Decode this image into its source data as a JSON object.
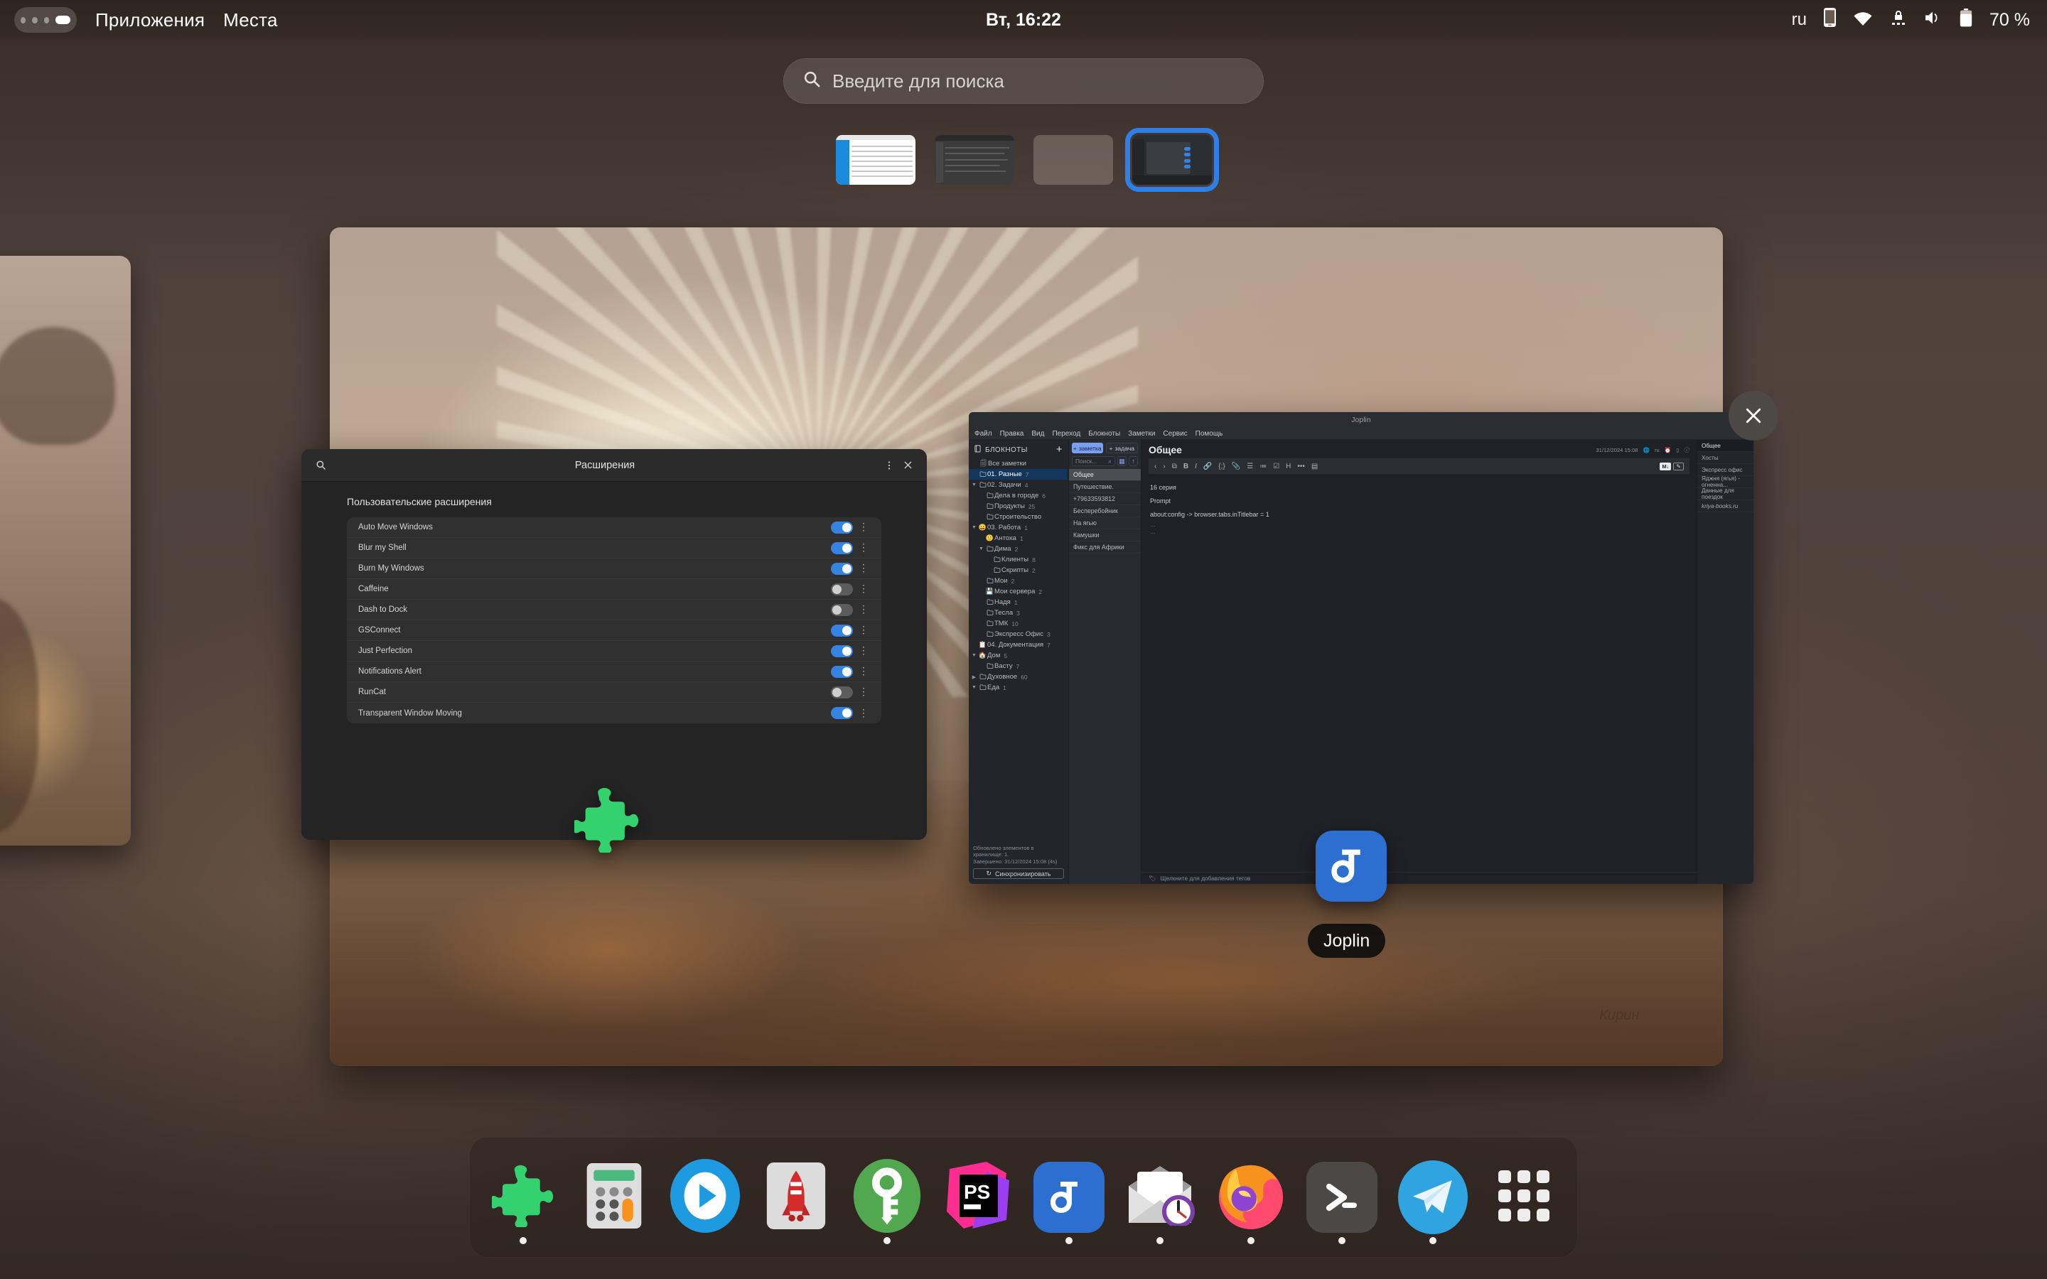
{
  "topbar": {
    "apps_label": "Приложения",
    "places_label": "Места",
    "clock": "Вт, 16:22",
    "lang": "ru",
    "battery": "70 %",
    "icons": [
      "phone-icon",
      "wifi-icon",
      "vpn-lock-icon",
      "volume-icon",
      "battery-icon"
    ]
  },
  "search": {
    "placeholder": "Введите для поиска",
    "icon": "search-icon"
  },
  "workspaces": {
    "count": 4,
    "selected_index": 3,
    "accent": "#2f7fe8"
  },
  "overview": {
    "close_label": "✕",
    "close_icon": "close-icon",
    "wallpaper_signature": "Кирин"
  },
  "extensions_window": {
    "title": "Расширения",
    "search_icon": "search-icon",
    "menu_icon": "kebab-menu-icon",
    "close_icon": "close-icon",
    "section_heading": "Пользовательские расширения",
    "rows": [
      {
        "name": "Auto Move Windows",
        "enabled": true
      },
      {
        "name": "Blur my Shell",
        "enabled": true
      },
      {
        "name": "Burn My Windows",
        "enabled": true
      },
      {
        "name": "Caffeine",
        "enabled": false
      },
      {
        "name": "Dash to Dock",
        "enabled": false
      },
      {
        "name": "GSConnect",
        "enabled": true
      },
      {
        "name": "Just Perfection",
        "enabled": true
      },
      {
        "name": "Notifications Alert",
        "enabled": true
      },
      {
        "name": "RunCat",
        "enabled": false
      },
      {
        "name": "Transparent Window Moving",
        "enabled": true
      }
    ]
  },
  "joplin": {
    "window_title": "Joplin",
    "menu": [
      "Файл",
      "Правка",
      "Вид",
      "Переход",
      "Блокноты",
      "Заметки",
      "Сервис",
      "Помощь"
    ],
    "sidebar": {
      "header": "БЛОКНОТЫ",
      "add_icon": "plus-icon",
      "all_notes": "Все заметки",
      "tree": [
        {
          "label": "01. Разные",
          "count": "7",
          "depth": 0,
          "icon": "folder-icon",
          "caret": "",
          "selected": true
        },
        {
          "label": "02. Задачи",
          "count": "4",
          "depth": 0,
          "icon": "folder-icon",
          "caret": "▼"
        },
        {
          "label": "Дела в городе",
          "count": "6",
          "depth": 1,
          "icon": "folder-icon",
          "caret": ""
        },
        {
          "label": "Продукты",
          "count": "25",
          "depth": 1,
          "icon": "folder-icon",
          "caret": ""
        },
        {
          "label": "Строительство",
          "count": "",
          "depth": 1,
          "icon": "folder-icon",
          "caret": ""
        },
        {
          "label": "03. Работа",
          "count": "1",
          "depth": 0,
          "icon": "😀",
          "caret": "▼"
        },
        {
          "label": "Антоха",
          "count": "1",
          "depth": 1,
          "icon": "🙂",
          "caret": ""
        },
        {
          "label": "Дима",
          "count": "2",
          "depth": 1,
          "icon": "folder-icon",
          "caret": "▼"
        },
        {
          "label": "Клиенты",
          "count": "8",
          "depth": 2,
          "icon": "folder-icon",
          "caret": ""
        },
        {
          "label": "Скрипты",
          "count": "2",
          "depth": 2,
          "icon": "folder-icon",
          "caret": ""
        },
        {
          "label": "Мои",
          "count": "2",
          "depth": 1,
          "icon": "folder-icon",
          "caret": ""
        },
        {
          "label": "Мои сервера",
          "count": "2",
          "depth": 1,
          "icon": "💾",
          "caret": ""
        },
        {
          "label": "Надя",
          "count": "1",
          "depth": 1,
          "icon": "folder-icon",
          "caret": ""
        },
        {
          "label": "Тесла",
          "count": "3",
          "depth": 1,
          "icon": "folder-icon",
          "caret": ""
        },
        {
          "label": "ТМК",
          "count": "10",
          "depth": 1,
          "icon": "folder-icon",
          "caret": ""
        },
        {
          "label": "Экспресс Офис",
          "count": "3",
          "depth": 1,
          "icon": "folder-icon",
          "caret": ""
        },
        {
          "label": "04. Документация",
          "count": "7",
          "depth": 0,
          "icon": "📋",
          "caret": ""
        },
        {
          "label": "Дом",
          "count": "5",
          "depth": 0,
          "icon": "🏠",
          "caret": "▼"
        },
        {
          "label": "Васту",
          "count": "7",
          "depth": 1,
          "icon": "folder-icon",
          "caret": ""
        },
        {
          "label": "Духовное",
          "count": "60",
          "depth": 0,
          "icon": "folder-icon",
          "caret": "▶"
        },
        {
          "label": "Еда",
          "count": "1",
          "depth": 0,
          "icon": "folder-icon",
          "caret": "▼"
        }
      ],
      "sync_message_line1": "Обновлено элементов в хранилище: 1.",
      "sync_message_line2": "Завершено: 31/12/2024 15:08 (4s)",
      "sync_button": "Синхронизировать",
      "sync_icon": "refresh-icon"
    },
    "notelist": {
      "new_note_button": "заметка",
      "new_todo_button": "задача",
      "search_placeholder": "Поиск...",
      "search_icon": "search-icon",
      "calendar_icon": "calendar-icon",
      "sort_icon": "sort-ascending-icon",
      "notes": [
        {
          "title": "Общее",
          "selected": true
        },
        {
          "title": "Путешествие.",
          "selected": false
        },
        {
          "title": "+79633593812",
          "selected": false
        },
        {
          "title": "Бесперебойник",
          "selected": false
        },
        {
          "title": "На ягью",
          "selected": false
        },
        {
          "title": "Камушки",
          "selected": false
        },
        {
          "title": "Фикс для Африки",
          "selected": false
        }
      ]
    },
    "editor": {
      "note_title": "Общее",
      "timestamp": "31/12/2024 15:08",
      "lang": "ru",
      "meta_icons": [
        "globe-icon",
        "alarm-icon",
        "split-view-icon",
        "info-icon"
      ],
      "toolbar_icons": [
        "back-icon",
        "forward-icon",
        "external-link-icon",
        "bold-icon",
        "italic-icon",
        "link-icon",
        "code-icon",
        "attach-icon",
        "bullet-list-icon",
        "numbered-list-icon",
        "checkbox-list-icon",
        "heading-icon",
        "more-icon",
        "insert-date-icon"
      ],
      "markdown_badge": "M↓",
      "edit_badge": "edit-icon",
      "lines": [
        "16 серия",
        "Prompt",
        "about:config -> browser.tabs.inTitlebar = 1",
        "...",
        "..."
      ],
      "tag_bar_text": "Щелкните для добавления тегов",
      "tag_bar_icon": "tag-icon"
    },
    "tags_panel": [
      {
        "label": "Общее",
        "selected": true,
        "italic": false
      },
      {
        "label": "Хосты",
        "selected": false,
        "italic": false
      },
      {
        "label": "Экспресс офис",
        "selected": false,
        "italic": false
      },
      {
        "label": "Яджня (ягья) - огненна...",
        "selected": false,
        "italic": false
      },
      {
        "label": "Данные для поездок",
        "selected": false,
        "italic": false
      },
      {
        "label": "kriya-books.ru",
        "selected": false,
        "italic": true
      }
    ]
  },
  "drag": {
    "app_label": "Joplin",
    "app_icon": "joplin-icon"
  },
  "dock": {
    "items": [
      {
        "name": "extensions",
        "icon": "puzzle-icon",
        "running": true
      },
      {
        "name": "calculator",
        "icon": "calculator-icon",
        "running": false
      },
      {
        "name": "media-player",
        "icon": "play-icon",
        "running": false
      },
      {
        "name": "rocket-launcher",
        "icon": "rocket-icon",
        "running": false
      },
      {
        "name": "password-manager",
        "icon": "key-icon",
        "running": true
      },
      {
        "name": "phpstorm",
        "icon": "ps-icon",
        "running": false
      },
      {
        "name": "joplin",
        "icon": "joplin-icon",
        "running": true
      },
      {
        "name": "mail-client",
        "icon": "envelope-clock-icon",
        "running": true
      },
      {
        "name": "firefox",
        "icon": "firefox-icon",
        "running": true
      },
      {
        "name": "terminal",
        "icon": "terminal-icon",
        "running": true
      },
      {
        "name": "telegram",
        "icon": "telegram-icon",
        "running": true
      },
      {
        "name": "show-applications",
        "icon": "grid-apps-icon",
        "running": false
      }
    ]
  }
}
